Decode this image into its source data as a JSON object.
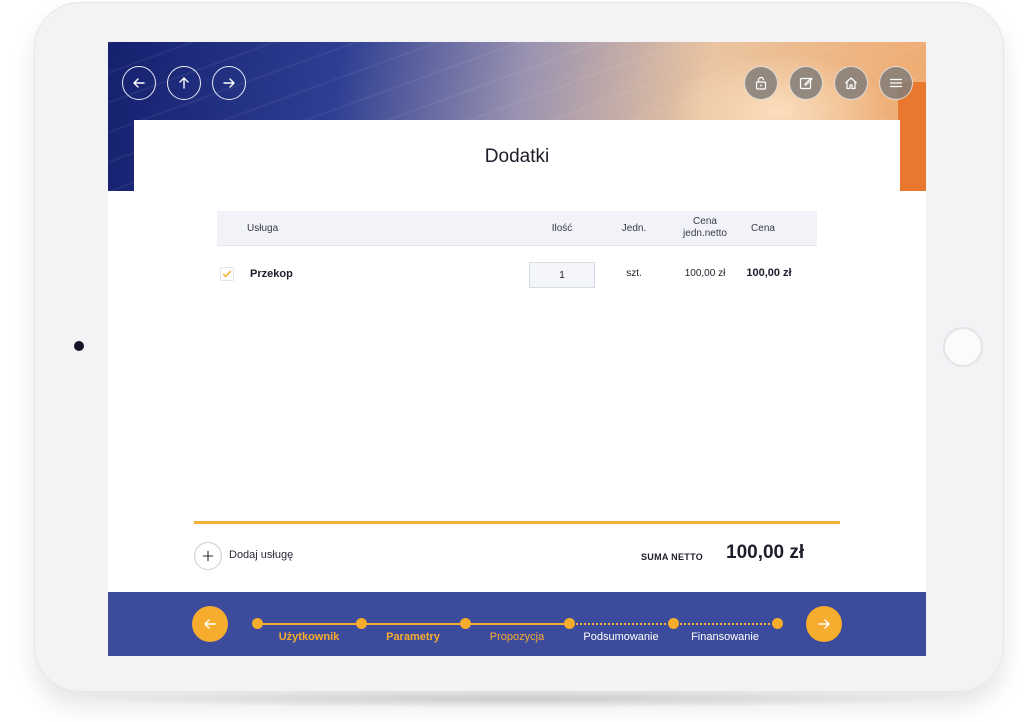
{
  "header": {
    "nav": {
      "back_icon": "arrow-left-icon",
      "up_icon": "arrow-up-icon",
      "forward_icon": "arrow-right-icon"
    },
    "tools": [
      "lock-icon",
      "edit-icon",
      "home-icon",
      "menu-icon"
    ]
  },
  "card": {
    "title": "Dodatki",
    "table": {
      "columns": {
        "service": "Usługa",
        "qty": "Ilość",
        "unit": "Jedn.",
        "unit_price_line1": "Cena",
        "unit_price_line2": "jedn.netto",
        "price": "Cena"
      },
      "rows": [
        {
          "checked": true,
          "name": "Przekop",
          "qty": "1",
          "unit": "szt.",
          "unit_price": "100,00 zł",
          "price": "100,00 zł"
        }
      ]
    },
    "add_service_label": "Dodaj usługę",
    "sum_label": "SUMA NETTO",
    "sum_value": "100,00 zł"
  },
  "stepper": {
    "steps": [
      {
        "label": "Użytkownik",
        "state": "done"
      },
      {
        "label": "Parametry",
        "state": "done"
      },
      {
        "label": "Propozycja",
        "state": "current"
      },
      {
        "label": "Podsumowanie",
        "state": "upcoming"
      },
      {
        "label": "Finansowanie",
        "state": "upcoming"
      }
    ]
  },
  "colors": {
    "accent": "#f6ad2e",
    "footer_bg": "#3d4b9c",
    "header_dark": "#15206e",
    "text": "#1d1d2b"
  }
}
